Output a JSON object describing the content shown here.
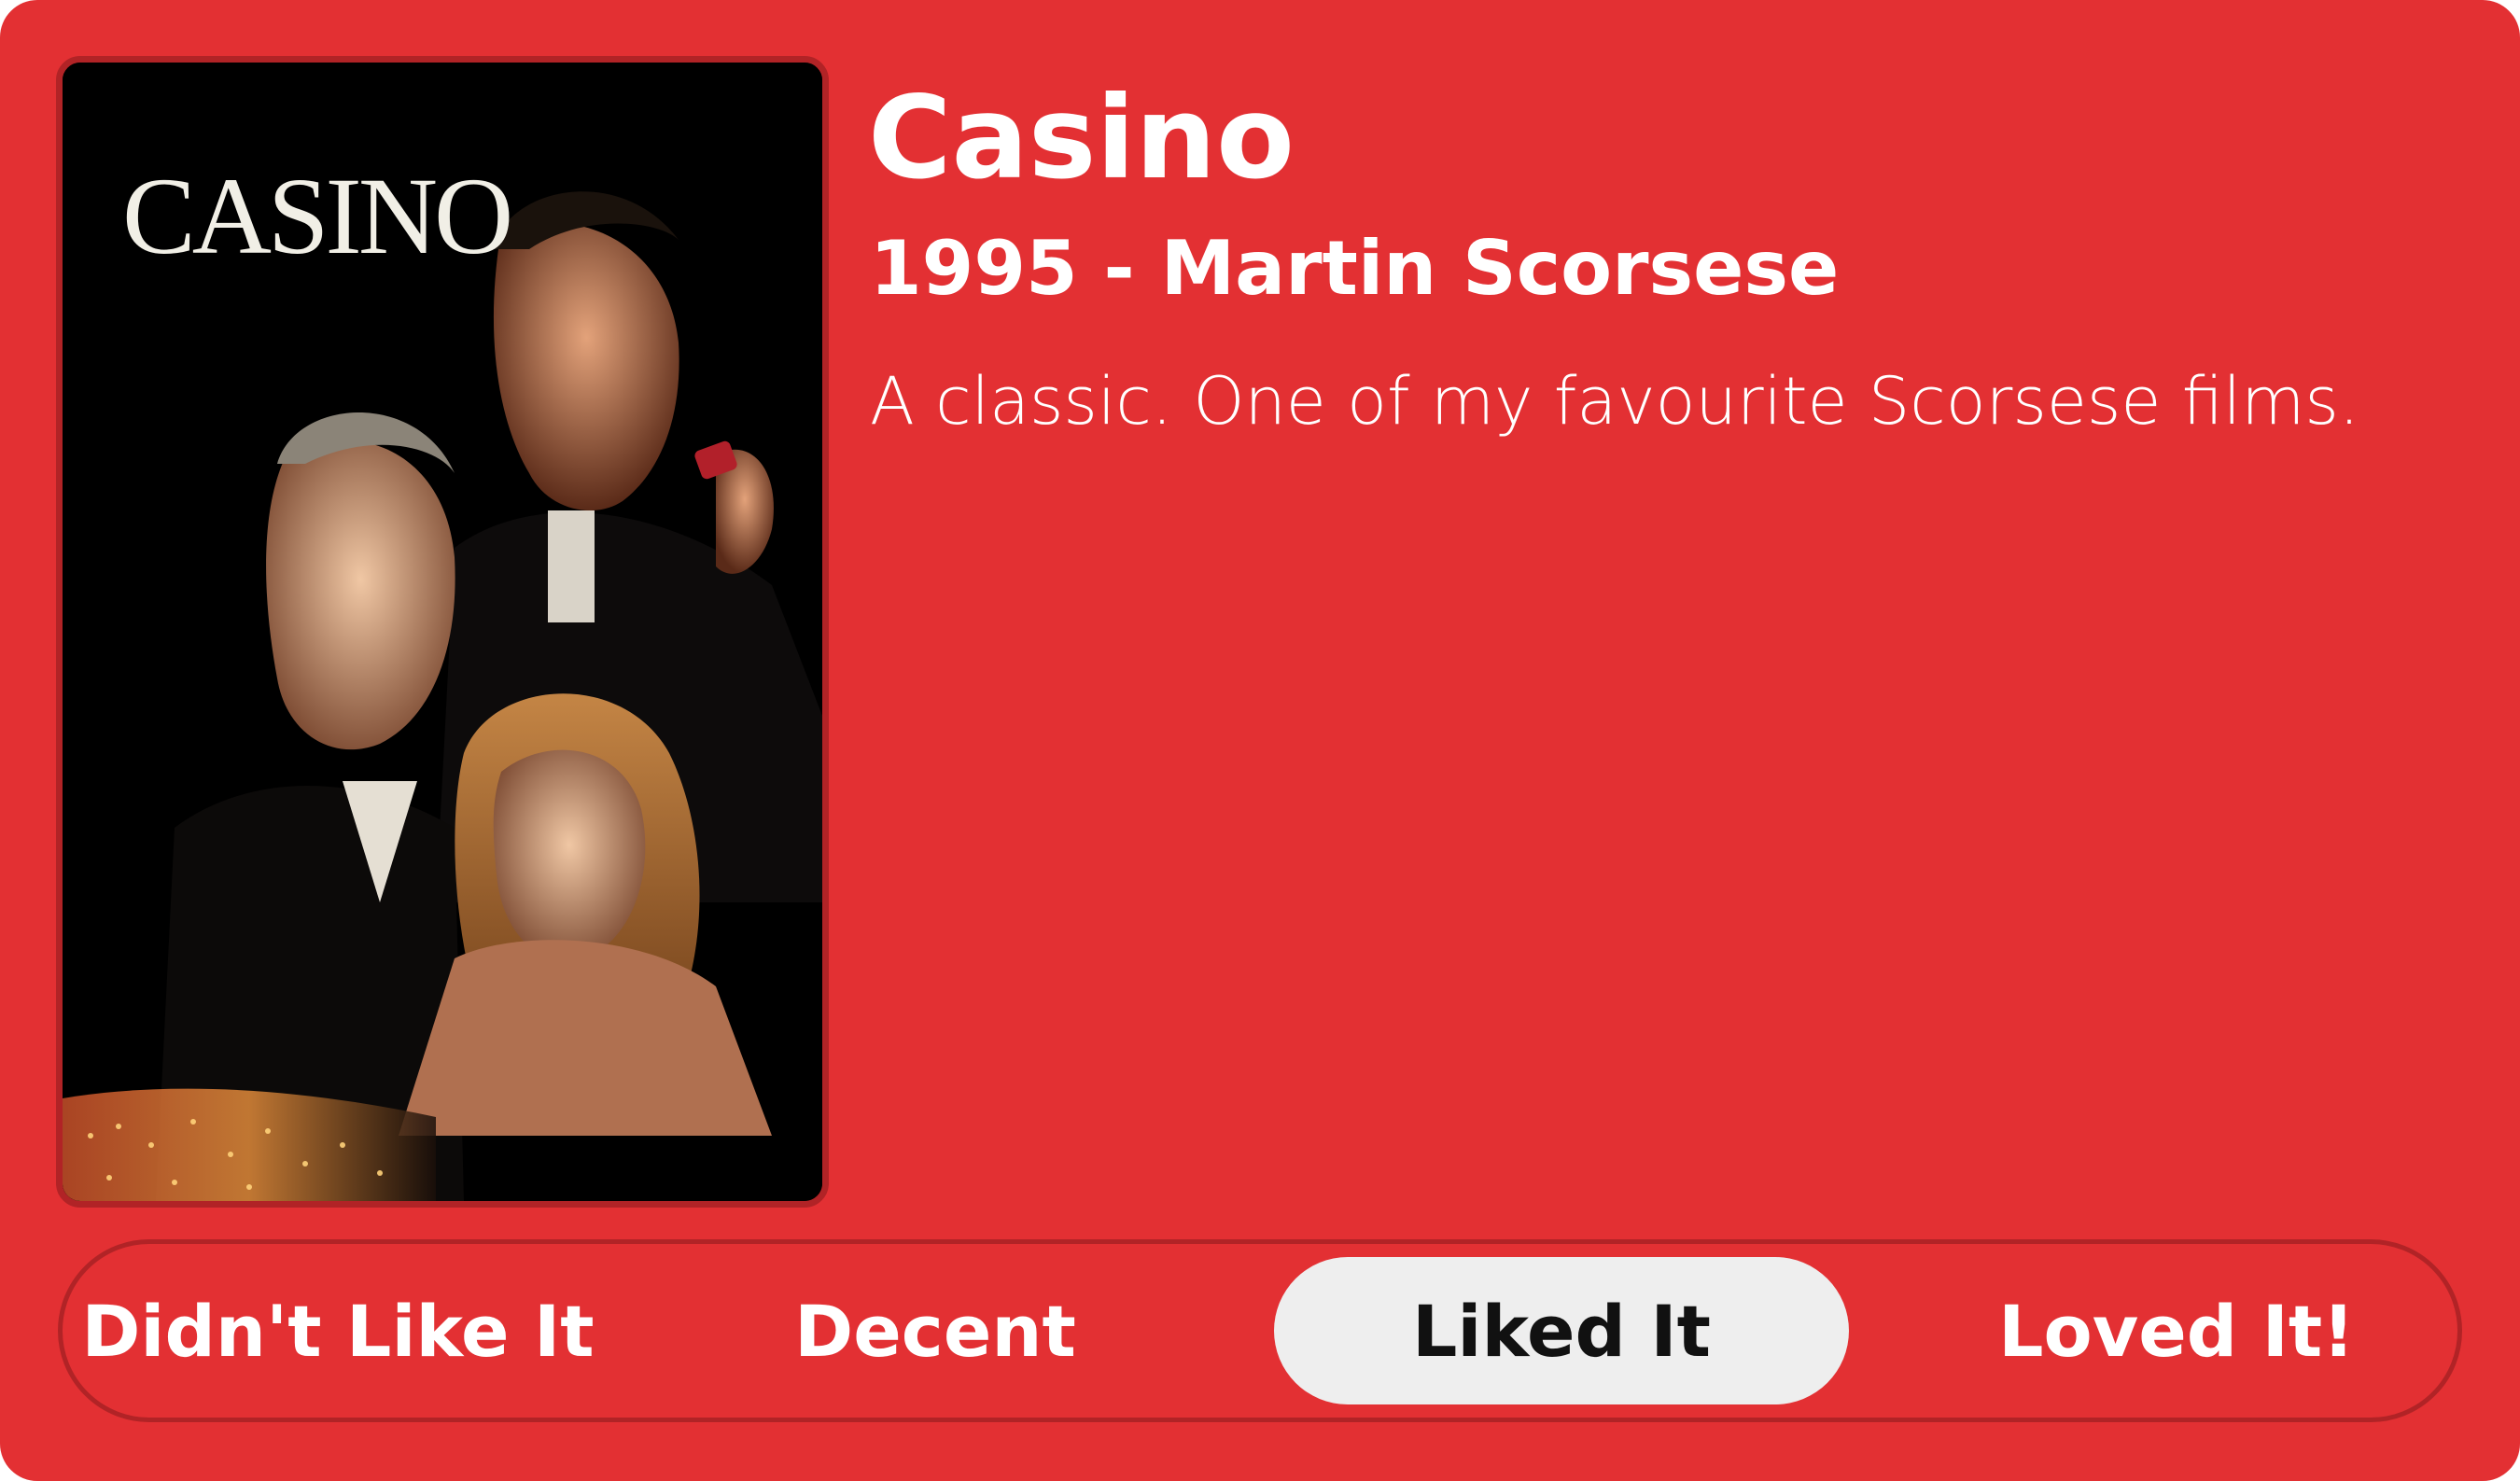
{
  "movie": {
    "title": "Casino",
    "year_director": "1995 - Martin Scorsese",
    "review": "A classic. One of my favourite Scorsese films.",
    "poster": {
      "wordmark": "CASINO",
      "icon": "movie-poster-image"
    }
  },
  "rating": {
    "options": [
      {
        "label": "Didn't Like It",
        "selected": false
      },
      {
        "label": "Decent",
        "selected": false
      },
      {
        "label": "Liked It",
        "selected": true
      },
      {
        "label": "Loved It!",
        "selected": false
      }
    ]
  },
  "colors": {
    "card_background": "#e33033",
    "border_accent": "#b12326",
    "selected_pill": "#eeeeee",
    "text": "#ffffff"
  }
}
